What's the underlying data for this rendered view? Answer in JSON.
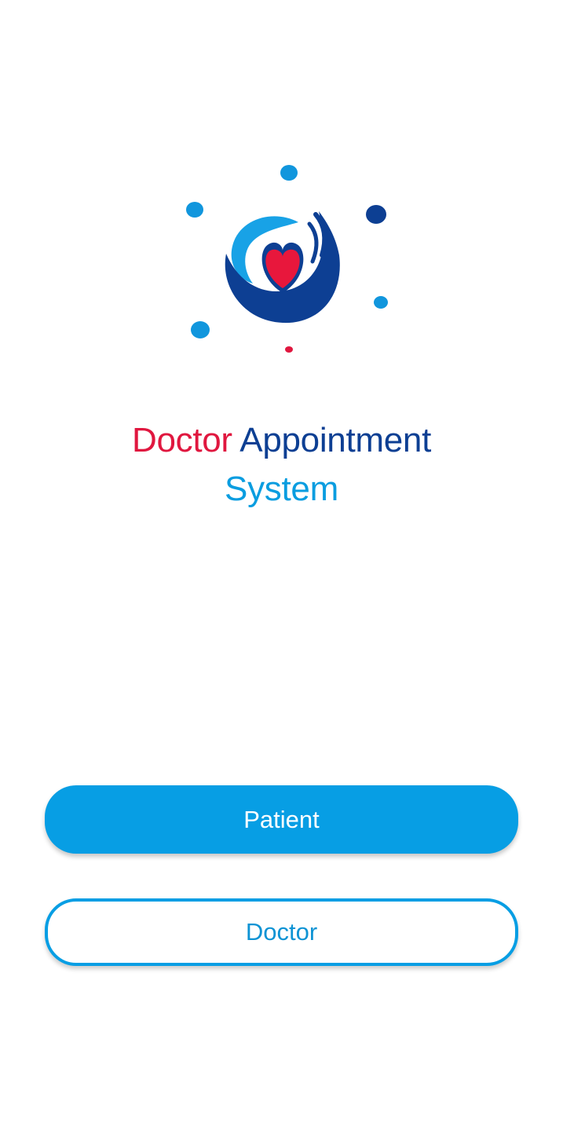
{
  "brand": {
    "logo_icon": "hand-holding-heart-icon",
    "colors": {
      "red": "#e0173f",
      "navy": "#0d3f93",
      "sky": "#0a9de0"
    }
  },
  "title": {
    "word1": "Doctor",
    "word2": "Appointment",
    "word3": "System"
  },
  "buttons": {
    "patient_label": "Patient",
    "doctor_label": "Doctor"
  }
}
